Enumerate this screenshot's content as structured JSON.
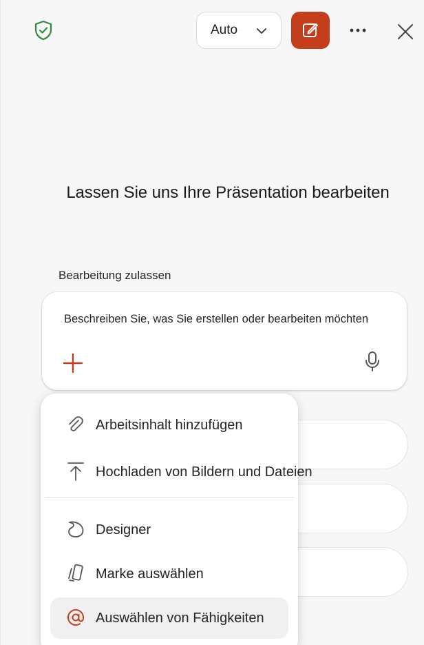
{
  "header": {
    "mode_select": {
      "value": "Auto"
    },
    "icons": {
      "shield": "shield-check-icon",
      "new": "compose-icon",
      "more": "more-horizontal-icon",
      "close": "close-icon"
    }
  },
  "main": {
    "heading": "Lassen Sie uns Ihre Präsentation bearbeiten",
    "permission_label": "Bearbeitung zulassen",
    "prompt": {
      "placeholder": "Beschreiben Sie, was Sie erstellen oder bearbeiten möchten"
    }
  },
  "menu": {
    "items": [
      {
        "label": "Arbeitsinhalt hinzufügen",
        "icon": "paperclip-icon"
      },
      {
        "label": "Hochladen von Bildern und Dateien",
        "icon": "upload-icon"
      },
      {
        "label": "Designer",
        "icon": "designer-icon"
      },
      {
        "label": "Marke auswählen",
        "icon": "brand-icon"
      },
      {
        "label": "Auswählen von Fähigkeiten",
        "icon": "at-icon",
        "selected": true
      }
    ]
  },
  "colors": {
    "accent": "#c43e1c",
    "shield": "#2e8b3e",
    "background": "#f7f7f7"
  }
}
